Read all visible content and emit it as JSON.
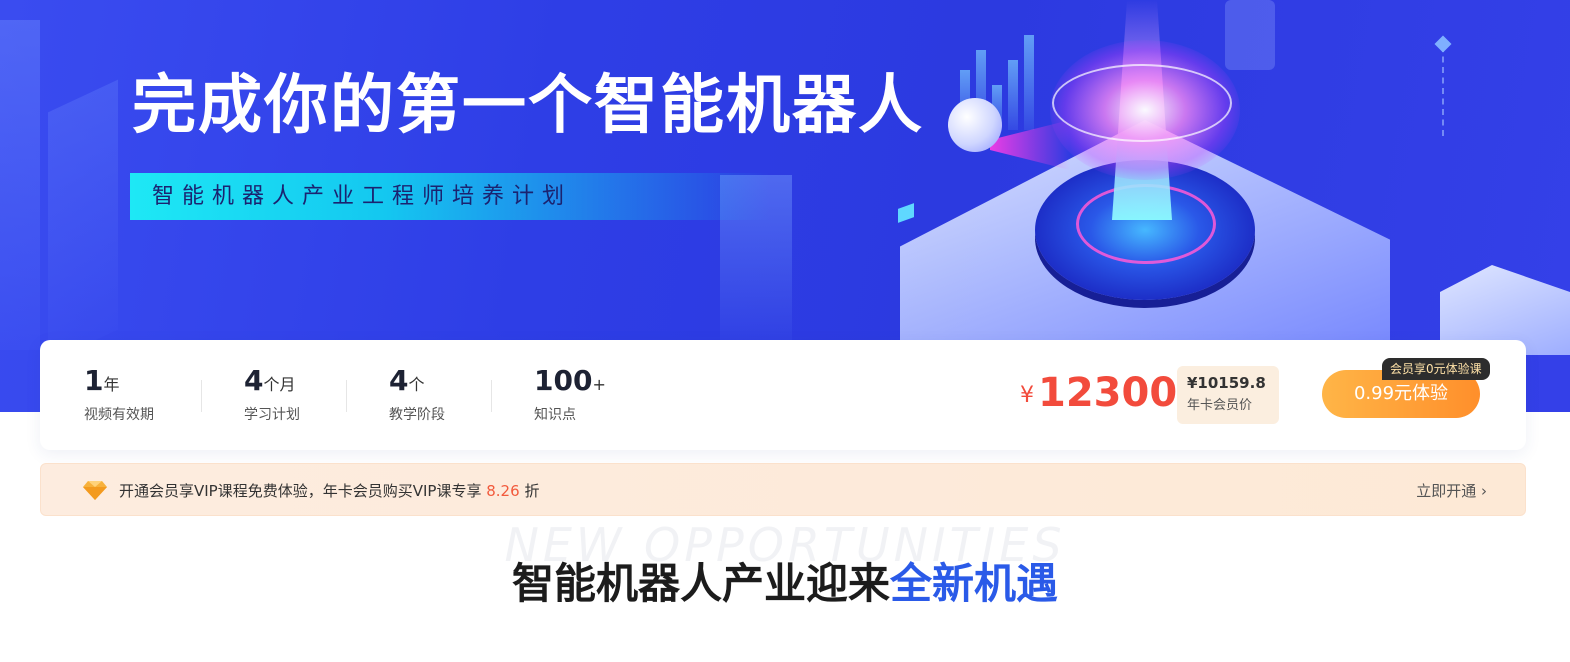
{
  "hero": {
    "title": "完成你的第一个智能机器人",
    "subtitle": "智能机器人产业工程师培养计划"
  },
  "stats": [
    {
      "num": "1",
      "unit": "年",
      "label": "视频有效期"
    },
    {
      "num": "4",
      "unit": "个月",
      "label": "学习计划"
    },
    {
      "num": "4",
      "unit": "个",
      "label": "教学阶段"
    },
    {
      "num": "100",
      "unit": "+",
      "label": "知识点"
    }
  ],
  "price": {
    "currency": "¥",
    "amount": "12300",
    "member_price": "¥10159.8",
    "member_label": "年卡会员价"
  },
  "cta": {
    "label": "0.99元体验",
    "tag": "会员享0元体验课"
  },
  "vip": {
    "text_before": "开通会员享VIP课程免费体验，年卡会员购买VIP课专享",
    "discount": "8.26",
    "text_after": "折",
    "link": "立即开通"
  },
  "section": {
    "bg_word": "NEW OPPORTUNITIES",
    "title_black": "智能机器人产业迎来",
    "title_blue": "全新机遇"
  },
  "colors": {
    "hero_blue": "#2e3ee6",
    "price_red": "#f24b3c",
    "cta_orange": "#ff8f2b",
    "accent_blue": "#2a5ae8"
  }
}
